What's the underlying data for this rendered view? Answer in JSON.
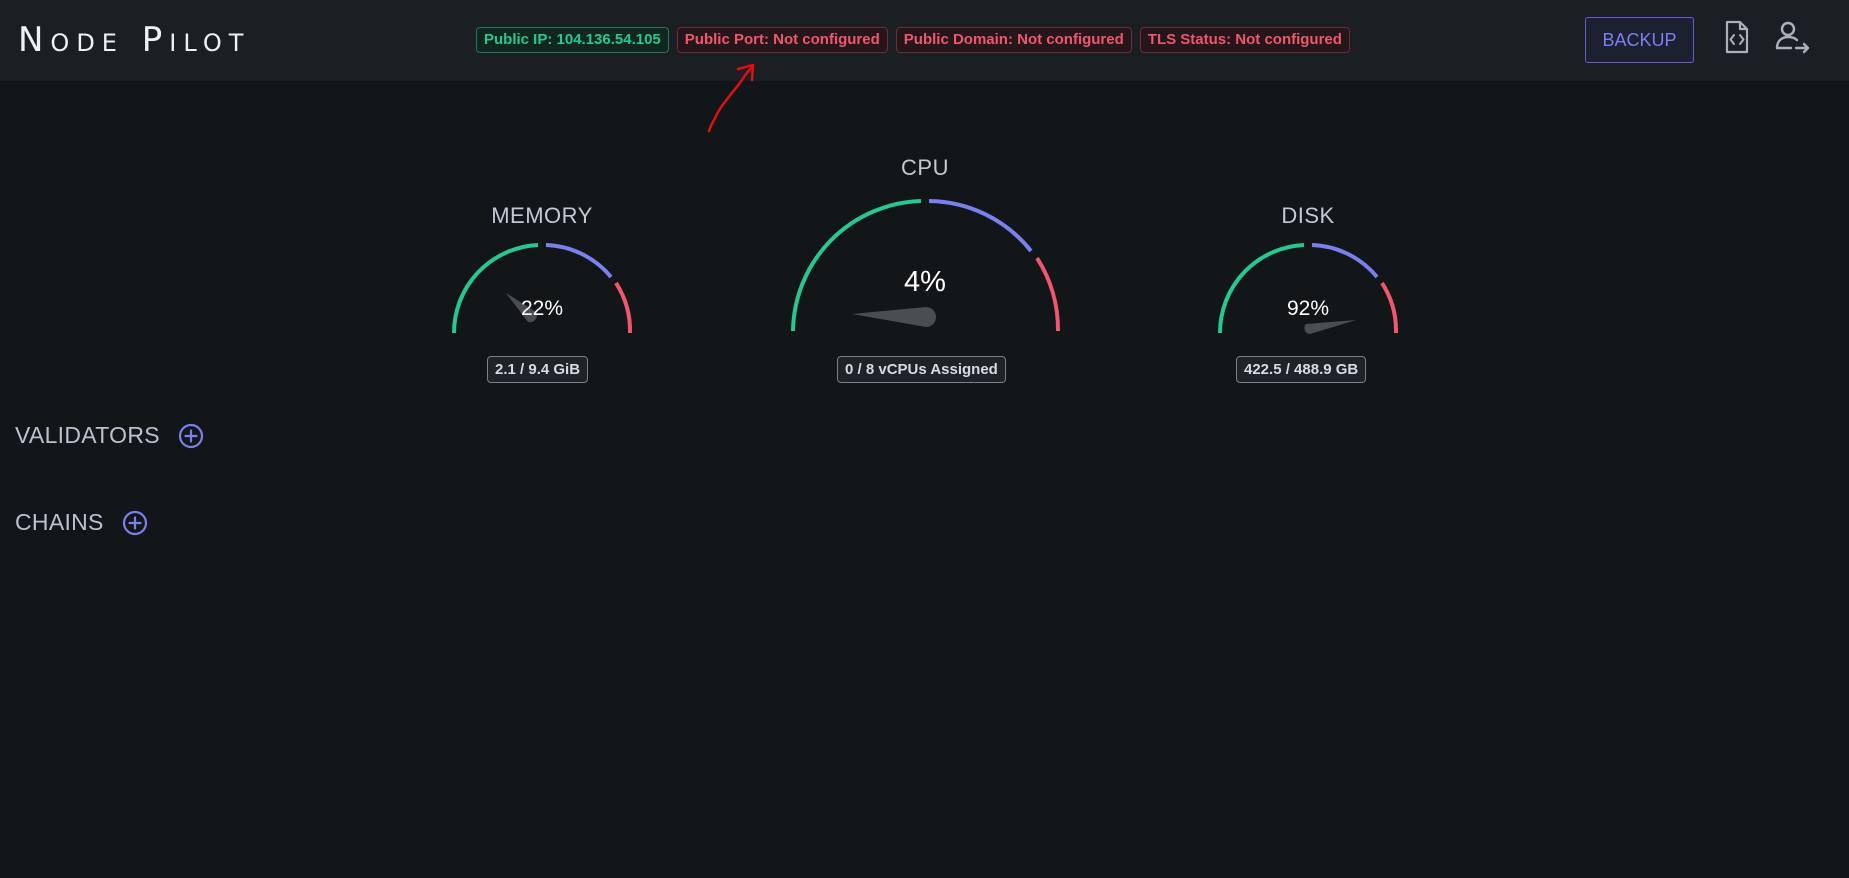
{
  "app": {
    "logo": "Node Pilot"
  },
  "header": {
    "badges": [
      {
        "label": "Public IP: 104.136.54.105",
        "status": "ok"
      },
      {
        "label": "Public Port: Not configured",
        "status": "error"
      },
      {
        "label": "Public Domain: Not configured",
        "status": "error"
      },
      {
        "label": "TLS Status: Not configured",
        "status": "error"
      }
    ],
    "backup_label": "BACKUP",
    "icons": [
      "code-file-icon",
      "user-logout-icon"
    ]
  },
  "gauges": {
    "memory": {
      "title": "MEMORY",
      "percent_label": "22%",
      "percent": 22,
      "detail": "2.1 / 9.4 GiB"
    },
    "cpu": {
      "title": "CPU",
      "percent_label": "4%",
      "percent": 4,
      "detail": "0 / 8 vCPUs Assigned"
    },
    "disk": {
      "title": "DISK",
      "percent_label": "92%",
      "percent": 92,
      "detail": "422.5 / 488.9 GB"
    }
  },
  "sections": {
    "validators": "VALIDATORS",
    "chains": "CHAINS"
  },
  "colors": {
    "ok": "#26c88f",
    "mid": "#7a80ee",
    "high": "#f0566e",
    "accent": "#5d63c9",
    "annotation": "#e01010"
  }
}
